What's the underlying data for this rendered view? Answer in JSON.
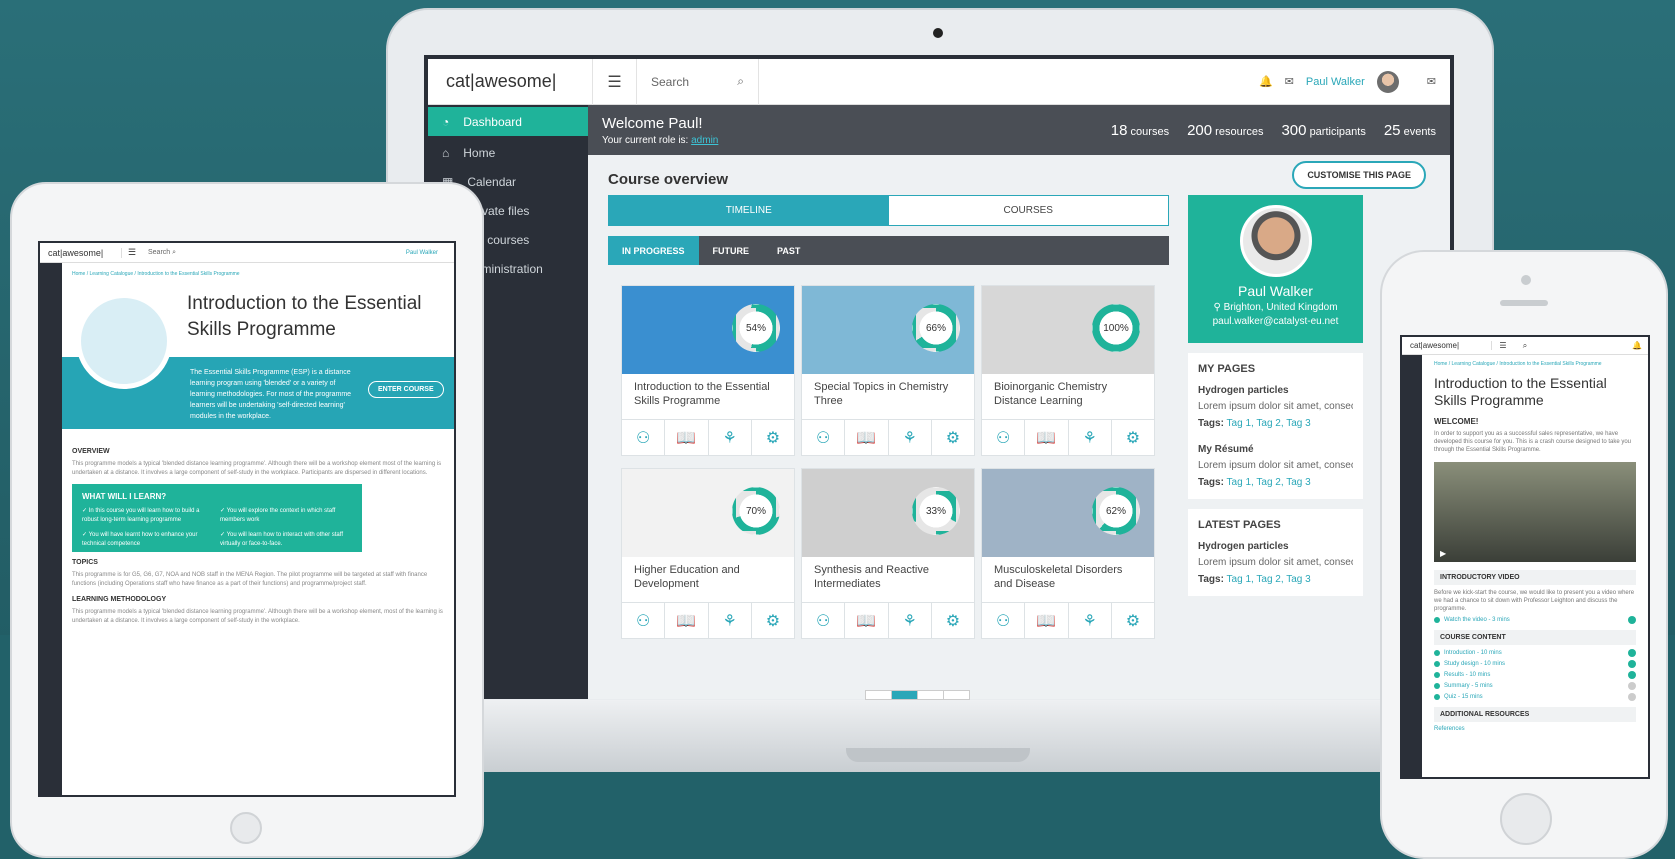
{
  "laptop": {
    "logo": "cat|awesome|",
    "search_placeholder": "Search",
    "user_name": "Paul Walker",
    "sidebar": [
      {
        "label": "Dashboard"
      },
      {
        "label": "Home"
      },
      {
        "label": "Calendar"
      },
      {
        "label": "Private files"
      },
      {
        "label": "My courses"
      },
      {
        "label": "Administration"
      }
    ],
    "welcome": {
      "title": "Welcome Paul!",
      "role_prefix": "Your current role is:",
      "role": "admin"
    },
    "stats": [
      {
        "num": "18",
        "label": "courses"
      },
      {
        "num": "200",
        "label": "resources"
      },
      {
        "num": "300",
        "label": "participants"
      },
      {
        "num": "25",
        "label": "events"
      }
    ],
    "course_overview": "Course overview",
    "customise": "CUSTOMISE THIS PAGE",
    "tabs": [
      "TIMELINE",
      "COURSES"
    ],
    "subtabs": [
      "IN PROGRESS",
      "FUTURE",
      "PAST"
    ],
    "courses": [
      {
        "title": "Introduction to the Essential Skills Programme",
        "progress": "54%",
        "progress_value": 0.54,
        "bg": "#3a8fd0"
      },
      {
        "title": "Special Topics in Chemistry Three",
        "progress": "66%",
        "progress_value": 0.66,
        "bg": "#7fb8d6"
      },
      {
        "title": "Bioinorganic Chemistry Distance Learning",
        "progress": "100%",
        "progress_value": 1.0,
        "bg": "#d7d7d7"
      },
      {
        "title": "Higher Education and Development",
        "progress": "70%",
        "progress_value": 0.7,
        "bg": "#f2f2f2"
      },
      {
        "title": "Synthesis and Reactive Intermediates",
        "progress": "33%",
        "progress_value": 0.33,
        "bg": "#cfcfcf"
      },
      {
        "title": "Musculoskeletal Disorders and Disease",
        "progress": "62%",
        "progress_value": 0.62,
        "bg": "#9fb3c6"
      }
    ],
    "profile": {
      "name": "Paul Walker",
      "location": "Brighton, United Kingdom",
      "email": "paul.walker@catalyst-eu.net"
    },
    "my_pages": {
      "title": "MY PAGES",
      "items": [
        {
          "title": "Hydrogen particles",
          "text": "Lorem ipsum dolor sit amet, consectetur adipiscing elit.",
          "tags_label": "Tags:",
          "tags": "Tag 1, Tag 2, Tag 3"
        },
        {
          "title": "My Résumé",
          "text": "Lorem ipsum dolor sit amet, consectetur adipiscing elit.",
          "tags_label": "Tags:",
          "tags": "Tag 1, Tag 2, Tag 3"
        }
      ]
    },
    "latest_pages": {
      "title": "LATEST PAGES",
      "items": [
        {
          "title": "Hydrogen particles",
          "text": "Lorem ipsum dolor sit amet, consectetur adipiscing elit.",
          "tags_label": "Tags:",
          "tags": "Tag 1, Tag 2, Tag 3"
        }
      ]
    }
  },
  "tablet": {
    "logo": "cat|awesome|",
    "search": "Search",
    "user": "Paul Walker",
    "breadcrumb": "Home / Learning Catalogue / Introduction to the Essential Skills Programme",
    "title": "Introduction to the Essential Skills Programme",
    "desc": "The Essential Skills Programme (ESP) is a distance learning program using 'blended' or a variety of learning methodologies. For most of the programme learners will be undertaking 'self-directed learning' modules in the workplace.",
    "enter": "ENTER COURSE",
    "overview_h": "OVERVIEW",
    "overview": "This programme models a typical 'blended distance learning programme'. Although there will be a workshop element most of the learning is undertaken at a distance. It involves a large component of self-study in the workplace. Participants are dispersed in different locations.",
    "learn_h": "WHAT WILL I LEARN?",
    "learn": [
      "In this course you will learn how to build a robust long-term learning programme",
      "You will explore the context in which staff members work",
      "You will have learnt how to enhance your technical competence",
      "You will learn how to interact with other staff virtually or face-to-face."
    ],
    "topics_h": "TOPICS",
    "topics": "This programme is for G5, G6, G7, NOA and NOB staff in the MENA Region. The pilot programme will be targeted at staff with finance functions (including Operations staff who have finance as a part of their functions) and programme/project staff.",
    "method_h": "LEARNING METHODOLOGY",
    "method": "This programme models a typical 'blended distance learning programme'. Although there will be a workshop element, most of the learning is undertaken at a distance. It involves a large component of self-study in the workplace."
  },
  "phone": {
    "logo": "cat|awesome|",
    "breadcrumb": "Home / Learning Catalogue / Introduction to the Essential Skills Programme",
    "title": "Introduction to the Essential Skills Programme",
    "welcome_h": "WELCOME!",
    "welcome": "In order to support you as a successful sales representative, we have developed this course for you. This is a crash course designed to take you through the Essential Skills Programme.",
    "video_h": "INTRODUCTORY VIDEO",
    "video_text": "Before we kick-start the course, we would like to present you a video where we had a chance to sit down with Professor Leighton and discuss the programme.",
    "watch": "Watch the video - 3 mins",
    "content_h": "COURSE CONTENT",
    "content": [
      {
        "label": "Introduction - 10 mins",
        "done": true
      },
      {
        "label": "Study design - 10 mins",
        "done": true
      },
      {
        "label": "Results - 10 mins",
        "done": true
      },
      {
        "label": "Summary - 5 mins",
        "done": false
      },
      {
        "label": "Quiz - 15 mins",
        "done": false
      }
    ],
    "additional_h": "ADDITIONAL RESOURCES",
    "references": "References"
  },
  "colors": {
    "teal": "#2aa7b8",
    "green": "#1fb39a",
    "dark": "#2a2f38"
  }
}
